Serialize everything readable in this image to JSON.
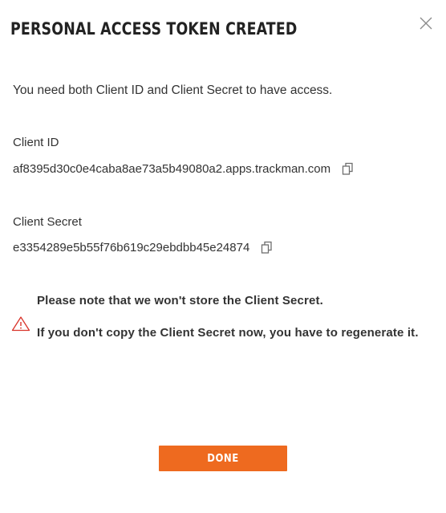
{
  "dialog": {
    "title": "PERSONAL ACCESS TOKEN CREATED",
    "intro": "You need both Client ID and Client Secret to have access.",
    "client_id": {
      "label": "Client ID",
      "value": "af8395d30c0e4caba8ae73a5b49080a2.apps.trackman.com"
    },
    "client_secret": {
      "label": "Client Secret",
      "value": "e3354289e5b55f76b619c29ebdbb45e24874"
    },
    "warning": {
      "line1": "Please note that we won't store the Client Secret.",
      "line2": "If you don't copy the Client Secret now, you have to regenerate it."
    },
    "done_label": "DONE"
  },
  "colors": {
    "accent": "#ee6a1f",
    "warning": "#d9342b",
    "text": "#333333",
    "icon": "#777777"
  },
  "icons": {
    "close": "close-icon",
    "copy": "copy-icon",
    "warning": "warning-triangle-icon"
  }
}
